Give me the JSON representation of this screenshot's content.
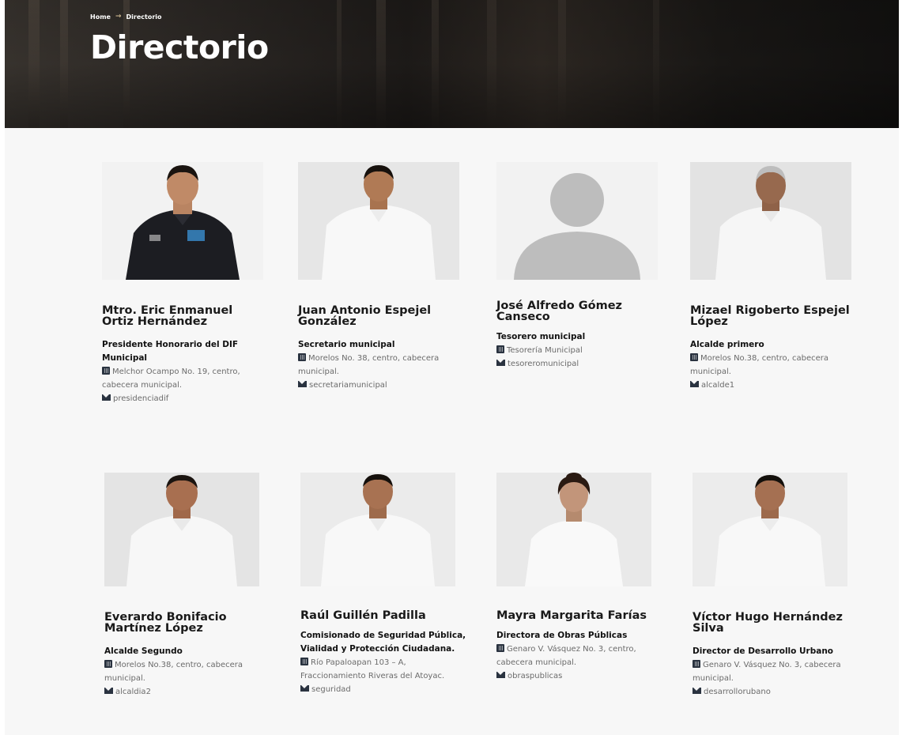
{
  "breadcrumb": {
    "home": "Home",
    "current": "Directorio"
  },
  "page_title": "Directorio",
  "icons": {
    "address": "building-icon",
    "email": "envelope-icon"
  },
  "people": [
    {
      "name": "Mtro. Eric Enmanuel Ortiz Hernández",
      "role": "Presidente Honorario del DIF Municipal",
      "address": "Melchor Ocampo No. 19, centro, cabecera municipal.",
      "email": "presidenciadif",
      "photo": "man-black-shirt"
    },
    {
      "name": "Juan Antonio Espejel González",
      "role": "Secretario municipal",
      "address": "Morelos No. 38, centro, cabecera municipal.",
      "email": "secretariamunicipal",
      "photo": "man-white-shirt"
    },
    {
      "name": "José Alfredo Gómez Canseco",
      "role": "Tesorero municipal",
      "address": "Tesorería Municipal",
      "email": "tesoreromunicipal",
      "photo": "placeholder-avatar"
    },
    {
      "name": "Mizael Rigoberto Espejel López",
      "role": "Alcalde primero",
      "address": "Morelos No.38, centro, cabecera municipal.",
      "email": "alcalde1",
      "photo": "man-white-shirt"
    },
    {
      "name": "Everardo Bonifacio Martínez López",
      "role": "Alcalde Segundo",
      "address": "Morelos No.38, centro, cabecera municipal.",
      "email": "alcaldia2",
      "photo": "man-white-shirt"
    },
    {
      "name": "Raúl Guillén Padilla",
      "role": "Comisionado de Seguridad Pública, Vialidad y Protección Ciudadana.",
      "address": "Río Papaloapan 103 – A, Fraccionamiento Riveras del Atoyac.",
      "email": "seguridad",
      "photo": "man-white-shirt"
    },
    {
      "name": "Mayra Margarita Farías",
      "role": "Directora de Obras Públicas",
      "address": "Genaro V. Vásquez No. 3, centro, cabecera municipal.",
      "email": "obraspublicas",
      "photo": "woman-white-blouse"
    },
    {
      "name": "Víctor Hugo Hernández Silva",
      "role": "Director de Desarrollo Urbano",
      "address": "Genaro V. Vásquez No. 3, cabecera municipal.",
      "email": "desarrollorubano",
      "photo": "man-white-shirt"
    }
  ]
}
